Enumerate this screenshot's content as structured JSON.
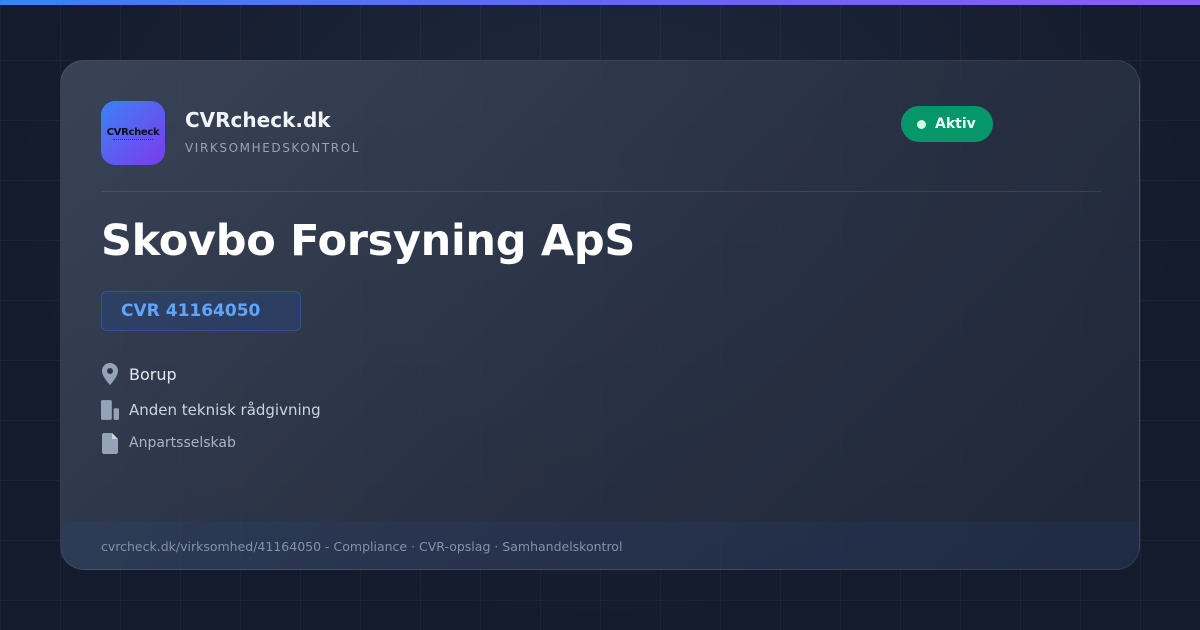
{
  "brand": {
    "logo_text": "CVRcheck",
    "name": "CVRcheck.dk",
    "subtitle": "VIRKSOMHEDSKONTROL"
  },
  "status": {
    "label": "Aktiv",
    "color": "#059669"
  },
  "company": {
    "name": "Skovbo Forsyning ApS",
    "cvr_label": "CVR",
    "cvr_number": "41164050"
  },
  "details": {
    "location": "Borup",
    "industry": "Anden teknisk rådgivning",
    "legal_form": "Anpartsselskab"
  },
  "icons": {
    "location": "map-pin-icon",
    "industry": "building-icon",
    "legal_form": "document-icon"
  },
  "footer": {
    "text": "cvrcheck.dk/virksomhed/41164050 - Compliance · CVR-opslag · Samhandelskontrol"
  },
  "colors": {
    "accent": "#3b82f6",
    "accent_purple": "#8b5cf6",
    "cvr_text": "#60a5fa",
    "background": "#141b2c"
  }
}
